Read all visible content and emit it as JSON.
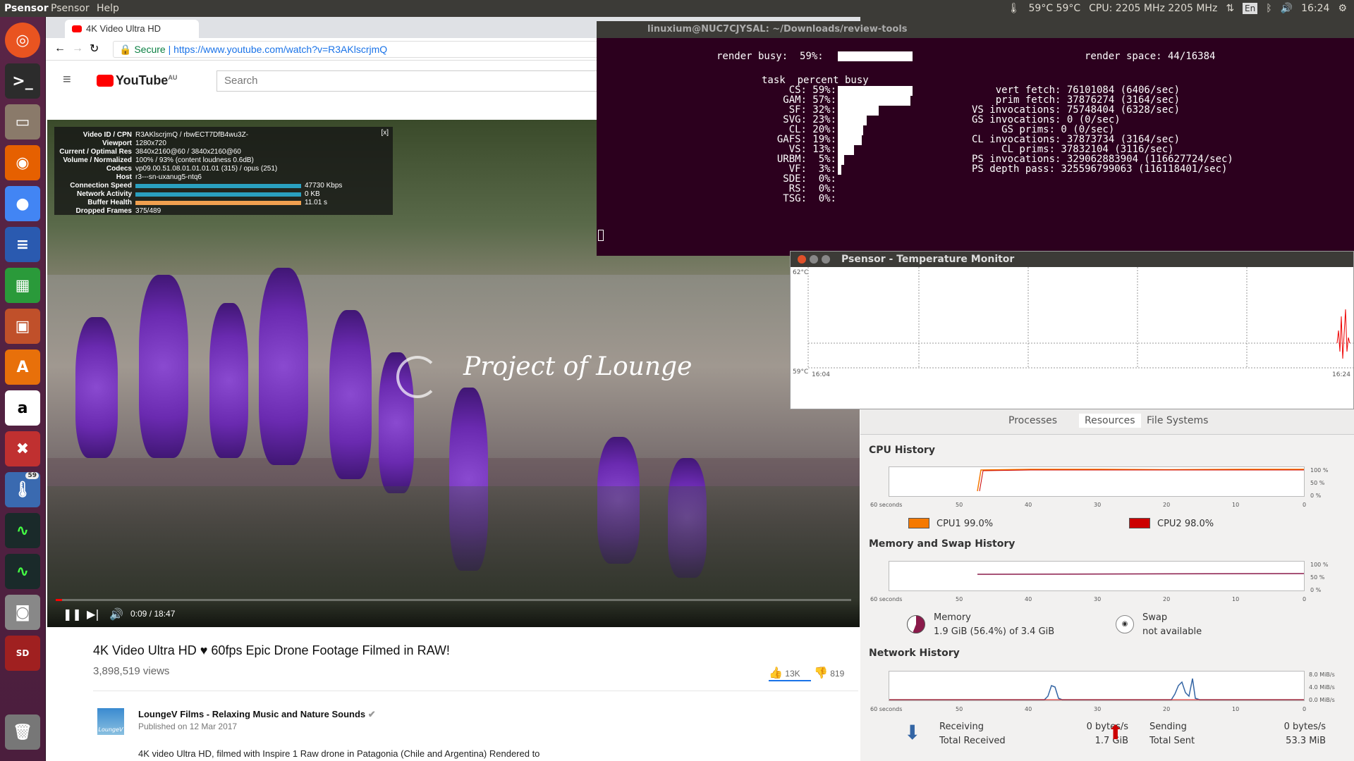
{
  "topbar": {
    "app": "Psensor",
    "menus": [
      "Psensor",
      "Help"
    ],
    "temps": "59°C 59°C",
    "cpu": "CPU: 2205 MHz 2205 MHz",
    "lang": "En",
    "clock": "16:24"
  },
  "launcher": {
    "items": [
      "ubuntu-icon",
      "terminal-icon",
      "files-icon",
      "firefox-icon",
      "chrome-icon",
      "writer-icon",
      "calc-icon",
      "impress-icon",
      "software-center-icon",
      "amazon-icon",
      "settings-icon",
      "thermometer-icon",
      "system-monitor-icon",
      "system-monitor-icon-2",
      "camera-icon",
      "sd-card-icon",
      "trash-icon"
    ],
    "badge": "59"
  },
  "chrome": {
    "tab_title": "4K Video Ultra HD",
    "secure": "Secure",
    "url": "https://www.youtube.com/watch?v=R3AKlscrjmQ"
  },
  "youtube": {
    "logo": "YouTube",
    "region": "AU",
    "search_placeholder": "Search",
    "stats": [
      {
        "k": "Video ID / CPN",
        "v": "R3AKlscrjmQ / rbwECT7DfB4wu3Z-"
      },
      {
        "k": "Viewport",
        "v": "1280x720"
      },
      {
        "k": "Current / Optimal Res",
        "v": "3840x2160@60 / 3840x2160@60"
      },
      {
        "k": "Volume / Normalized",
        "v": "100% / 93% (content loudness 0.6dB)"
      },
      {
        "k": "Codecs",
        "v": "vp09.00.51.08.01.01.01.01 (315) / opus (251)"
      },
      {
        "k": "Host",
        "v": "r3---sn-uxanug5-ntq6"
      },
      {
        "k": "Connection Speed",
        "v": "47730 Kbps"
      },
      {
        "k": "Network Activity",
        "v": "0 KB"
      },
      {
        "k": "Buffer Health",
        "v": "11.01 s"
      },
      {
        "k": "Dropped Frames",
        "v": "375/489"
      }
    ],
    "close": "[x]",
    "overlay_text": "Project of Lounge",
    "time": "0:09 / 18:47",
    "progress": 0.008,
    "title": "4K Video Ultra HD ♥ 60fps Epic Drone Footage Filmed in RAW!",
    "views": "3,898,519 views",
    "likes": "13K",
    "dislikes": "819",
    "channel": "LoungeV Films - Relaxing Music and Nature Sounds",
    "published": "Published on 12 Mar 2017",
    "description": "4K video Ultra HD, filmed with Inspire 1 Raw drone in Patagonia (Chile and Argentina) Rendered to",
    "channel_logo": "LoungeV"
  },
  "terminal": {
    "title": "linuxium@NUC7CJYSAL: ~/Downloads/review-tools",
    "render_busy": "render busy:  59%:",
    "render_space": "render space: 44/16384",
    "header": "task  percent busy",
    "tasks": [
      {
        "t": "CS:",
        "p": "59%:",
        "f": 0.59
      },
      {
        "t": "GAM:",
        "p": "57%:",
        "f": 0.57
      },
      {
        "t": "SF:",
        "p": "32%:",
        "f": 0.32
      },
      {
        "t": "SVG:",
        "p": "23%:",
        "f": 0.23
      },
      {
        "t": "CL:",
        "p": "20%:",
        "f": 0.2
      },
      {
        "t": "GAFS:",
        "p": "19%:",
        "f": 0.19
      },
      {
        "t": "VS:",
        "p": "13%:",
        "f": 0.13
      },
      {
        "t": "URBM:",
        "p": "5%:",
        "f": 0.05
      },
      {
        "t": "VF:",
        "p": "3%:",
        "f": 0.03
      },
      {
        "t": "SDE:",
        "p": "0%:",
        "f": 0
      },
      {
        "t": "RS:",
        "p": "0%:",
        "f": 0
      },
      {
        "t": "TSG:",
        "p": "0%:",
        "f": 0
      }
    ],
    "stats": [
      "    vert fetch: 76101084 (6406/sec)",
      "    prim fetch: 37876274 (3164/sec)",
      "VS invocations: 75748404 (6328/sec)",
      "GS invocations: 0 (0/sec)",
      "     GS prims: 0 (0/sec)",
      "CL invocations: 37873734 (3164/sec)",
      "     CL prims: 37832104 (3116/sec)",
      "PS invocations: 329062883904 (116627724/sec)",
      "PS depth pass: 325596799063 (116118401/sec)"
    ]
  },
  "psensor": {
    "title": "Psensor - Temperature Monitor",
    "ymax": "62°C",
    "ymin": "59°C",
    "xstart": "16:04",
    "xend": "16:24"
  },
  "sysmon": {
    "tabs": [
      "Processes",
      "Resources",
      "File Systems"
    ],
    "cpu_title": "CPU History",
    "mem_title": "Memory and Swap History",
    "net_title": "Network History",
    "x_labels": [
      "60 seconds",
      "50",
      "40",
      "30",
      "20",
      "10",
      "0"
    ],
    "pct_labels": [
      "100 %",
      "50 %",
      "0 %"
    ],
    "net_labels": [
      "8.0 MiB/s",
      "4.0 MiB/s",
      "0.0 MiB/s"
    ],
    "cpu1": "CPU1  99.0%",
    "cpu2": "CPU2  98.0%",
    "cpu1_color": "#f57900",
    "cpu2_color": "#cc0000",
    "memory": "Memory",
    "memory_val": "1.9 GiB (56.4%) of 3.4 GiB",
    "swap": "Swap",
    "swap_val": "not available",
    "receiving": "Receiving",
    "recv_rate": "0 bytes/s",
    "total_received": "Total Received",
    "recv_total": "1.7 GiB",
    "sending": "Sending",
    "send_rate": "0 bytes/s",
    "total_sent": "Total Sent",
    "send_total": "53.3 MiB"
  }
}
